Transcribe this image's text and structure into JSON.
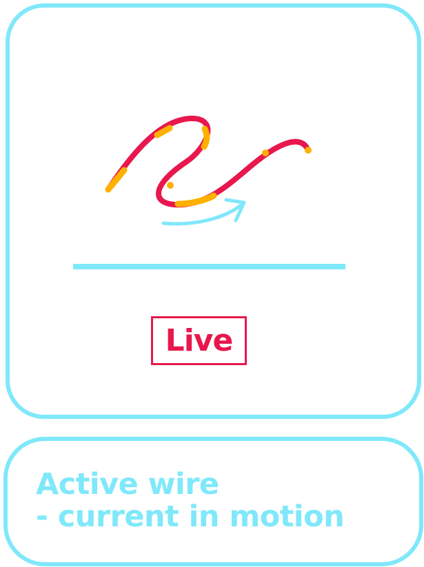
{
  "badge": {
    "label": "Live"
  },
  "caption": {
    "line1": "Active wire",
    "line2": "- current in motion"
  },
  "colors": {
    "outline": "#7fe8fa",
    "wire": "#e8174d",
    "current": "#ffb000",
    "arrow": "#7fe8fa",
    "background": "#ffffff"
  },
  "icons": [
    "wire-icon",
    "motion-arrow-icon"
  ]
}
